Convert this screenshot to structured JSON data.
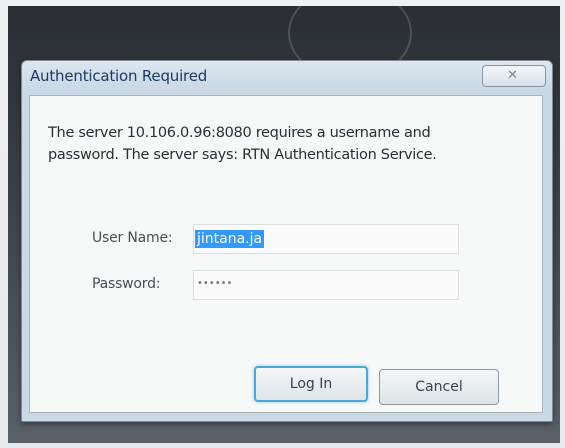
{
  "dialog": {
    "title": "Authentication Required",
    "close_symbol": "✕",
    "message_line1": "The server 10.106.0.96:8080 requires a username and",
    "message_line2": "password. The server says: RTN Authentication Service.",
    "username_label": "User Name:",
    "username_value": "jintana.ja",
    "password_label": "Password:",
    "password_value": "••••••",
    "login_button": "Log In",
    "cancel_button": "Cancel"
  },
  "icons": {
    "close": "close-icon"
  },
  "colors": {
    "selection": "#3399ff",
    "title_text": "#1d3a63",
    "focus_border": "#4aa8d8"
  }
}
